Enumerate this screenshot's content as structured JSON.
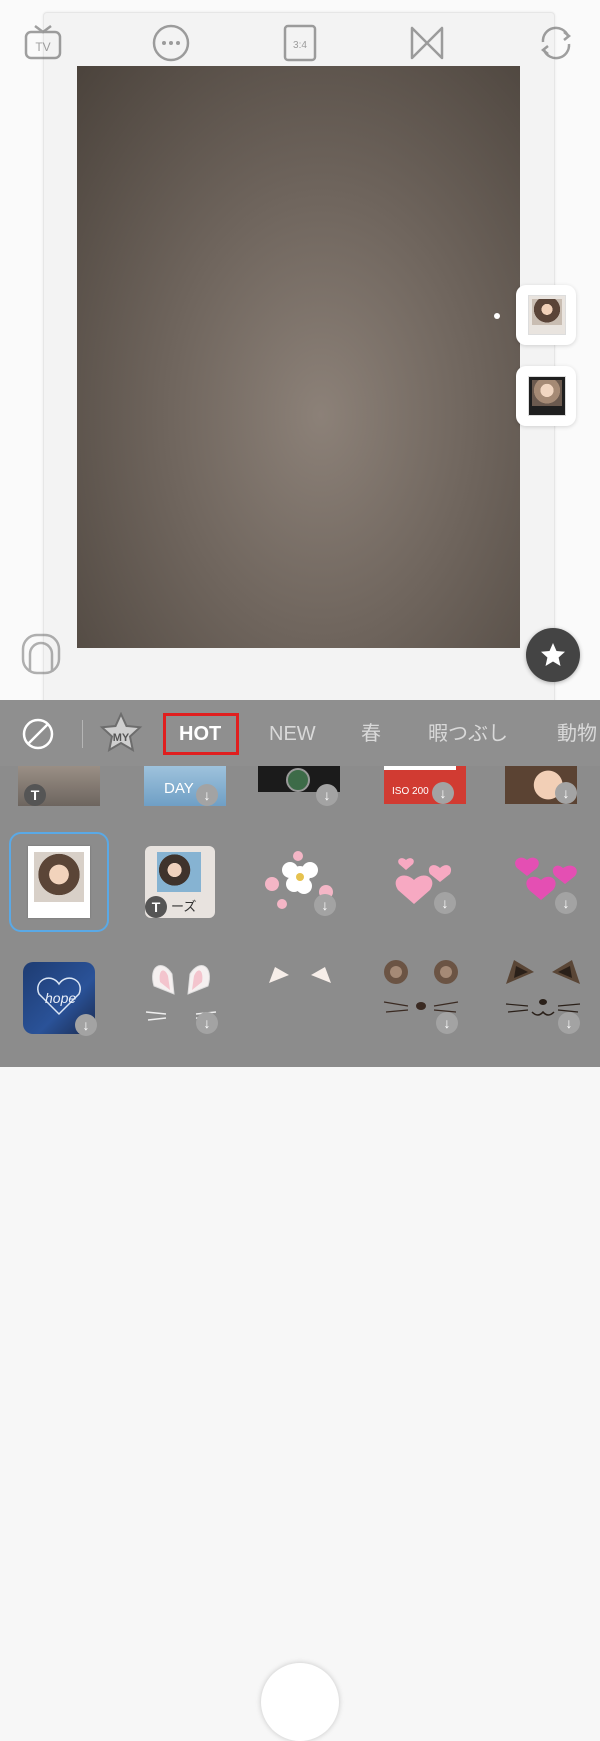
{
  "top_icons": [
    "tv-icon",
    "more-icon",
    "aspect-ratio-icon",
    "flip-effect-icon",
    "switch-camera-icon"
  ],
  "tabs": {
    "my_label": "MY",
    "items": [
      "HOT",
      "NEW",
      "春",
      "暇つぶし",
      "動物"
    ],
    "active": "HOT"
  },
  "stickers": {
    "row1_labels": [
      "DAY",
      "ISO 200"
    ],
    "row2_label_text": "ーズ",
    "row3_label_text": "hope"
  },
  "colors": {
    "highlight_box": "#e01e1e",
    "selected_border": "#5aa9e6",
    "panel_bg": "#8c8c8c"
  }
}
